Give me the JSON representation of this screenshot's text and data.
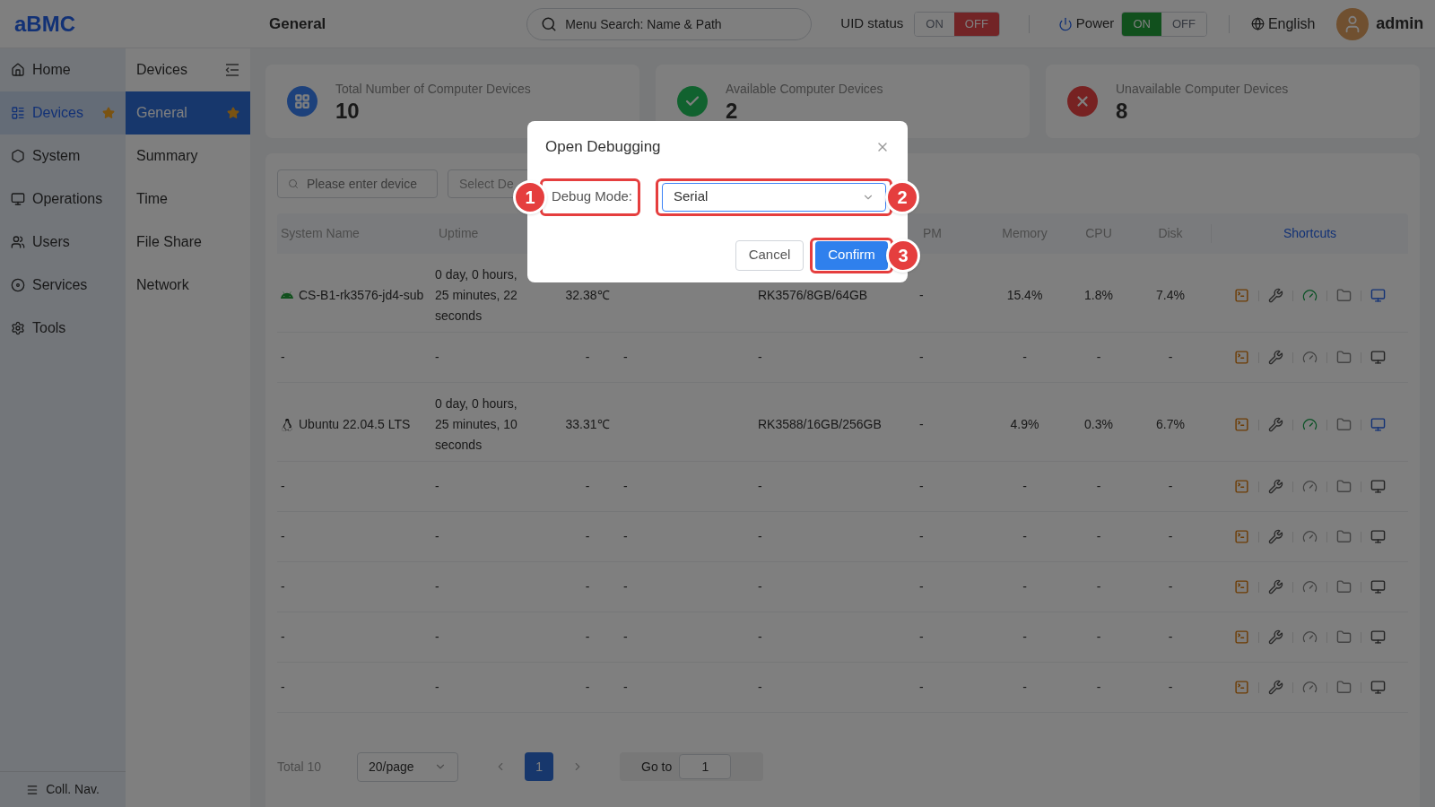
{
  "header": {
    "logo": "aBMC",
    "page_title": "General",
    "search": {
      "placeholder": "Menu Search: Name & Path"
    },
    "uid_status": {
      "label": "UID status",
      "options": [
        {
          "label": "ON",
          "selected": false
        },
        {
          "label": "OFF",
          "selected": true
        }
      ]
    },
    "power": {
      "label": "Power",
      "options": [
        {
          "label": "ON",
          "selected": true
        },
        {
          "label": "OFF",
          "selected": false
        }
      ]
    },
    "language": "English",
    "user": "admin"
  },
  "sidebar": {
    "items": [
      {
        "label": "Home",
        "selected": false,
        "starred": false
      },
      {
        "label": "Devices",
        "selected": true,
        "starred": true
      },
      {
        "label": "System",
        "selected": false,
        "starred": false
      },
      {
        "label": "Operations",
        "selected": false,
        "starred": false
      },
      {
        "label": "Users",
        "selected": false,
        "starred": false
      },
      {
        "label": "Services",
        "selected": false,
        "starred": false
      },
      {
        "label": "Tools",
        "selected": false,
        "starred": false
      }
    ],
    "collapse_label": "Coll. Nav."
  },
  "subnav": {
    "title": "Devices",
    "items": [
      {
        "label": "General",
        "selected": true,
        "starred": true
      },
      {
        "label": "Summary",
        "selected": false,
        "starred": false
      },
      {
        "label": "Time",
        "selected": false,
        "starred": false
      },
      {
        "label": "File Share",
        "selected": false,
        "starred": false
      },
      {
        "label": "Network",
        "selected": false,
        "starred": false
      }
    ]
  },
  "stats": [
    {
      "label": "Total Number of Computer Devices",
      "value": "10",
      "kind": "total"
    },
    {
      "label": "Available Computer Devices",
      "value": "2",
      "kind": "available"
    },
    {
      "label": "Unavailable Computer Devices",
      "value": "8",
      "kind": "unavailable"
    }
  ],
  "filters": {
    "search": {
      "placeholder": "Please enter device"
    },
    "select": {
      "placeholder": "Select De"
    }
  },
  "table": {
    "columns": [
      "System Name",
      "Uptime",
      "PM",
      "Memory",
      "CPU",
      "Disk",
      "Shortcuts"
    ],
    "rows": [
      {
        "kind": "android",
        "online": true,
        "name": "CS-B1-rk3576-jd4-sub",
        "uptime": "0 day, 0 hours, 25 minutes, 22 seconds",
        "temperature": "32.38℃",
        "column_5": "RK3576/8GB/64GB",
        "pm": "-",
        "memory": "15.4%",
        "cpu": "1.8%",
        "disk": "7.4%"
      },
      {
        "online": false,
        "name": "-",
        "uptime": "-",
        "temperature": "-",
        "column_4": "-",
        "column_5": "-",
        "pm": "-",
        "memory": "-",
        "cpu": "-",
        "disk": "-"
      },
      {
        "kind": "linux",
        "online": true,
        "name": "Ubuntu 22.04.5 LTS",
        "uptime": "0 day, 0 hours, 25 minutes, 10 seconds",
        "temperature": "33.31℃",
        "column_5": "RK3588/16GB/256GB",
        "pm": "-",
        "memory": "4.9%",
        "cpu": "0.3%",
        "disk": "6.7%"
      },
      {
        "online": false,
        "name": "-",
        "uptime": "-",
        "temperature": "-",
        "column_4": "-",
        "column_5": "-",
        "pm": "-",
        "memory": "-",
        "cpu": "-",
        "disk": "-"
      },
      {
        "online": false,
        "name": "-",
        "uptime": "-",
        "temperature": "-",
        "column_4": "-",
        "column_5": "-",
        "pm": "-",
        "memory": "-",
        "cpu": "-",
        "disk": "-"
      },
      {
        "online": false,
        "name": "-",
        "uptime": "-",
        "temperature": "-",
        "column_4": "-",
        "column_5": "-",
        "pm": "-",
        "memory": "-",
        "cpu": "-",
        "disk": "-"
      },
      {
        "online": false,
        "name": "-",
        "uptime": "-",
        "temperature": "-",
        "column_4": "-",
        "column_5": "-",
        "pm": "-",
        "memory": "-",
        "cpu": "-",
        "disk": "-"
      },
      {
        "online": false,
        "name": "-",
        "uptime": "-",
        "temperature": "-",
        "column_4": "-",
        "column_5": "-",
        "pm": "-",
        "memory": "-",
        "cpu": "-",
        "disk": "-"
      }
    ]
  },
  "pagination": {
    "total": "Total 10",
    "page_size": "20/page",
    "pages": [
      {
        "label": "1",
        "selected": true
      }
    ],
    "goto_label": "Go to",
    "goto_value": "1"
  },
  "dialog": {
    "title": "Open Debugging",
    "field_label": "Debug Mode:",
    "value": "Serial",
    "buttons": [
      {
        "label": "Cancel",
        "kind": "secondary"
      },
      {
        "label": "Confirm",
        "kind": "primary"
      }
    ],
    "markers": [
      "1",
      "2",
      "3"
    ]
  }
}
